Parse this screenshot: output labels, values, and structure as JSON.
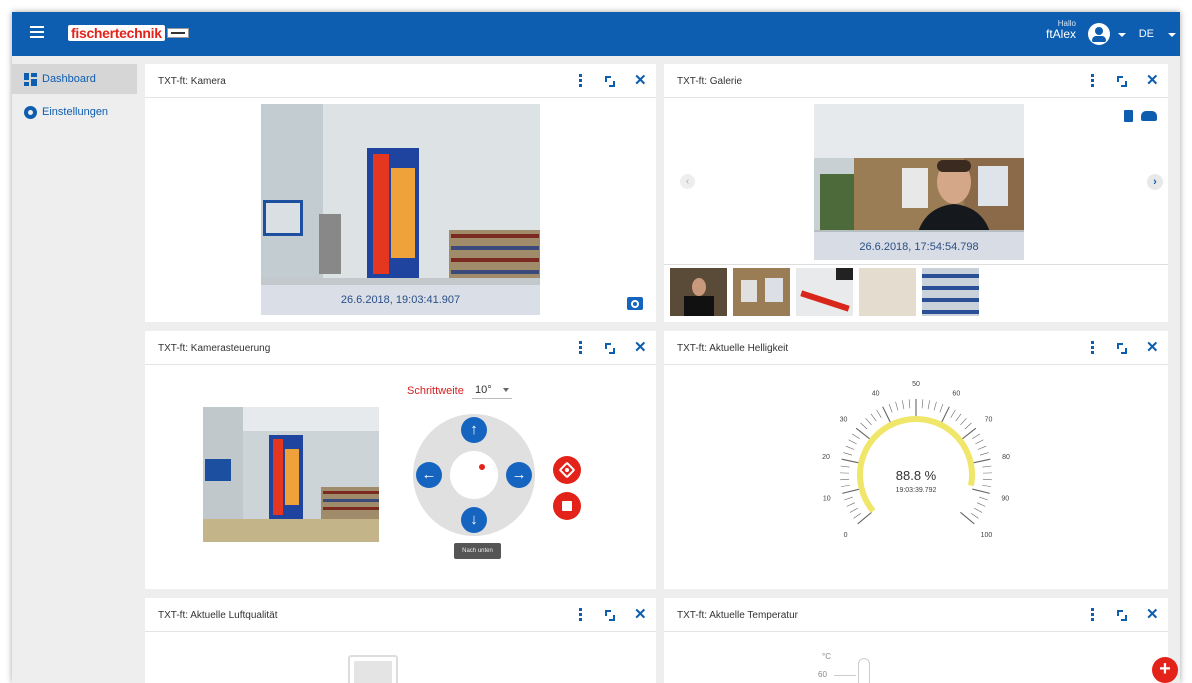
{
  "header": {
    "logo_text": "fischertechnik",
    "user_greeting": "Hallo",
    "user_name": "ftAlex",
    "language": "DE"
  },
  "sidebar": {
    "items": [
      {
        "label": "Dashboard",
        "icon": "dashboard-icon",
        "active": true
      },
      {
        "label": "Einstellungen",
        "icon": "gear-icon",
        "active": false
      }
    ]
  },
  "cards": {
    "kamera": {
      "title": "TXT-ft: Kamera",
      "timestamp": "26.6.2018, 19:03:41.907"
    },
    "galerie": {
      "title": "TXT-ft: Galerie",
      "timestamp": "26.6.2018, 17:54:54.798",
      "thumbnail_count": 5
    },
    "steuerung": {
      "title": "TXT-ft: Kamerasteuerung",
      "step_label": "Schrittweite",
      "step_value": "10°",
      "tooltip": "Nach unten"
    },
    "helligkeit": {
      "title": "TXT-ft: Aktuelle Helligkeit",
      "value_text": "88.8 %",
      "time_text": "19:03:39.792",
      "level": 88.8,
      "ticks": [
        "0",
        "10",
        "20",
        "30",
        "40",
        "50",
        "60",
        "70",
        "80",
        "90",
        "100"
      ]
    },
    "luft": {
      "title": "TXT-ft: Aktuelle Luftqualität"
    },
    "temperatur": {
      "title": "TXT-ft: Aktuelle Temperatur",
      "unit": "°C",
      "axis_top": "60"
    }
  },
  "colors": {
    "primary": "#0d5db0",
    "accent": "#e32319"
  }
}
